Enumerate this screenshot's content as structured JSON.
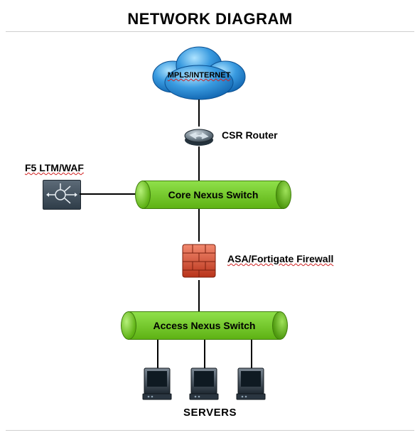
{
  "title": "NETWORK DIAGRAM",
  "nodes": {
    "cloud": {
      "label": "MPLS/INTERNET"
    },
    "router": {
      "label": "CSR Router"
    },
    "f5": {
      "label": "F5 LTM/WAF"
    },
    "core_switch": {
      "label": "Core Nexus Switch"
    },
    "firewall": {
      "label": "ASA/Fortigate Firewall"
    },
    "access_switch": {
      "label": "Access Nexus  Switch"
    },
    "servers": {
      "label": "SERVERS",
      "count": 3
    }
  },
  "connections": [
    [
      "cloud",
      "router"
    ],
    [
      "router",
      "core_switch"
    ],
    [
      "f5",
      "core_switch"
    ],
    [
      "core_switch",
      "firewall"
    ],
    [
      "firewall",
      "access_switch"
    ],
    [
      "access_switch",
      "server1"
    ],
    [
      "access_switch",
      "server2"
    ],
    [
      "access_switch",
      "server3"
    ]
  ],
  "colors": {
    "switch_green": "#6fc11e",
    "firewall_red": "#d84a2f",
    "cloud_blue": "#2a86d6"
  }
}
